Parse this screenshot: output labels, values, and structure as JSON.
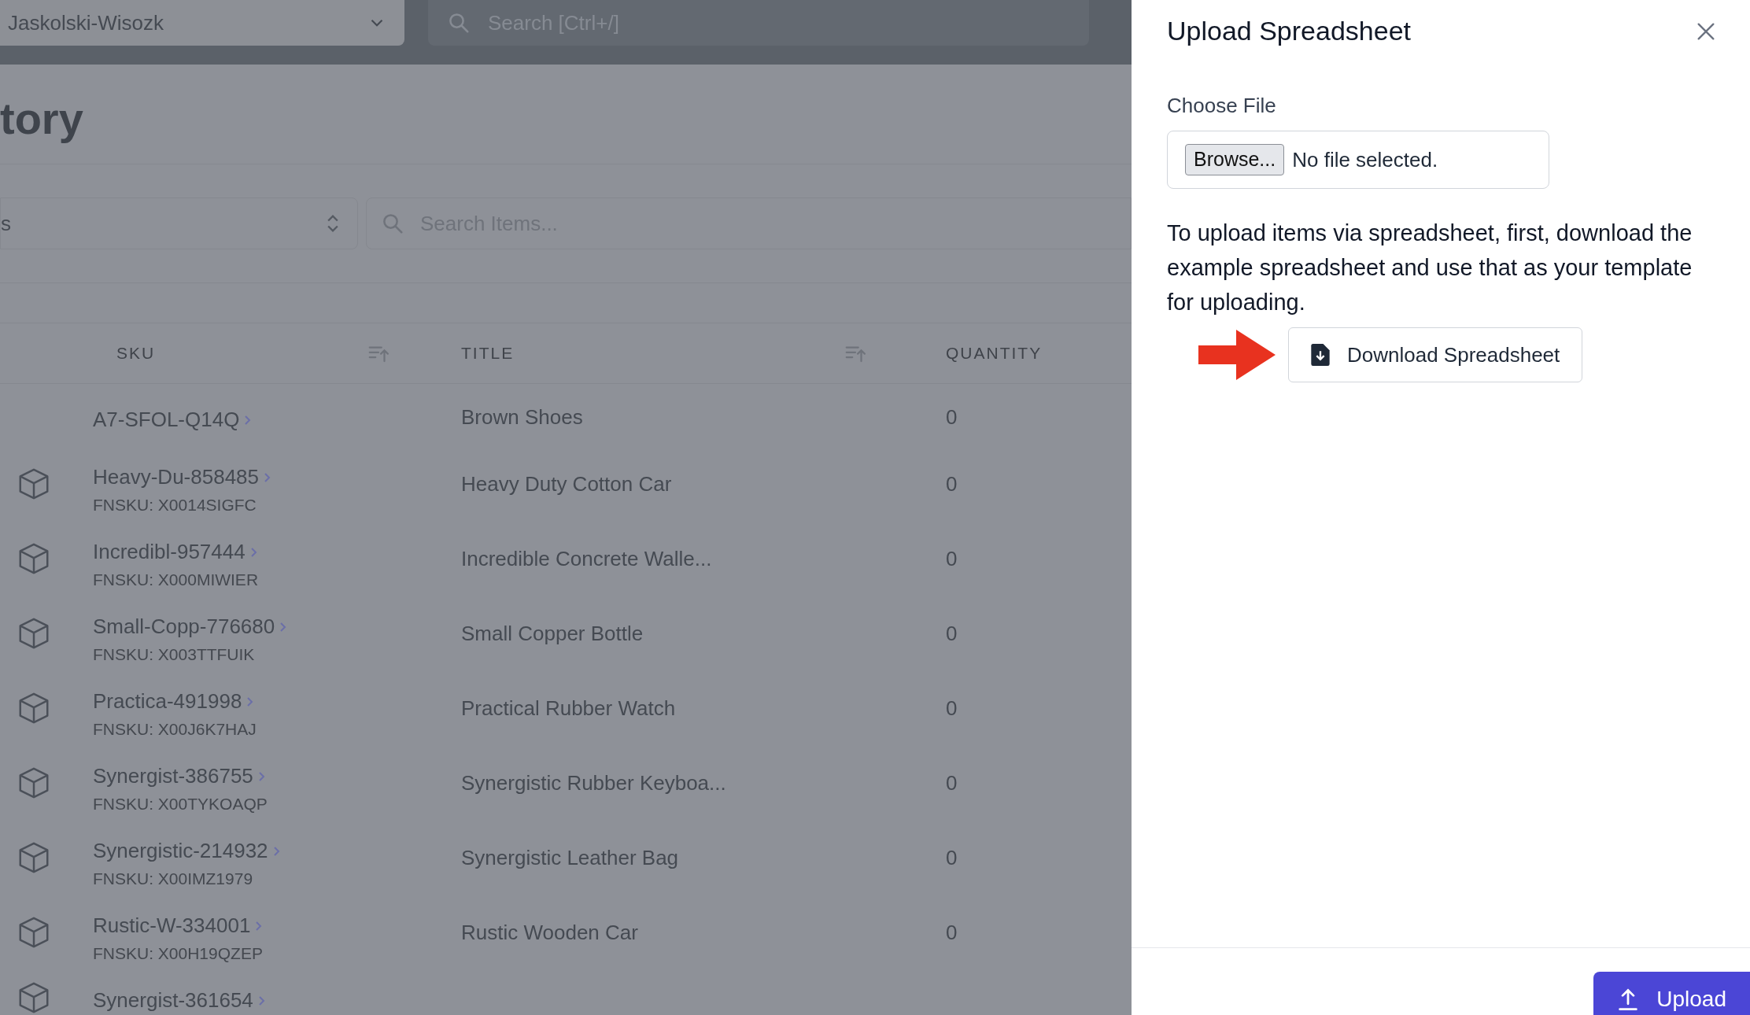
{
  "top_bar": {
    "org_select": "Jaskolski-Wisozk",
    "search_placeholder": "Search [Ctrl+/]"
  },
  "page": {
    "title": "tory",
    "filter_select": "s",
    "search_placeholder": "Search Items...",
    "table": {
      "columns": [
        {
          "label": "SKU",
          "kind": "sortable"
        },
        {
          "label": "TITLE",
          "kind": "sortable"
        },
        {
          "label": "QUANTITY",
          "kind": "plain"
        }
      ],
      "rows": [
        {
          "kind": "plain",
          "sku": "A7-SFOL-Q14Q",
          "title": "Brown Shoes",
          "quantity": "0"
        },
        {
          "kind": "box",
          "sku": "Heavy-Du-858485",
          "fnsku": "FNSKU: X0014SIGFC",
          "title": "Heavy Duty Cotton Car",
          "quantity": "0"
        },
        {
          "kind": "box",
          "sku": "Incredibl-957444",
          "fnsku": "FNSKU: X000MIWIER",
          "title": "Incredible Concrete Walle...",
          "quantity": "0"
        },
        {
          "kind": "box",
          "sku": "Small-Copp-776680",
          "fnsku": "FNSKU: X003TTFUIK",
          "title": "Small Copper Bottle",
          "quantity": "0"
        },
        {
          "kind": "box",
          "sku": "Practica-491998",
          "fnsku": "FNSKU: X00J6K7HAJ",
          "title": "Practical Rubber Watch",
          "quantity": "0"
        },
        {
          "kind": "box",
          "sku": "Synergist-386755",
          "fnsku": "FNSKU: X00TYKOAQP",
          "title": "Synergistic Rubber Keyboa...",
          "quantity": "0"
        },
        {
          "kind": "box",
          "sku": "Synergistic-214932",
          "fnsku": "FNSKU: X00IMZ1979",
          "title": "Synergistic Leather Bag",
          "quantity": "0"
        },
        {
          "kind": "box",
          "sku": "Rustic-W-334001",
          "fnsku": "FNSKU: X00H19QZEP",
          "title": "Rustic Wooden Car",
          "quantity": "0"
        },
        {
          "kind": "box",
          "sku": "Synergist-361654"
        }
      ]
    }
  },
  "panel": {
    "title": "Upload Spreadsheet",
    "file_label": "Choose File",
    "browse_button": "Browse...",
    "file_status": "No file selected.",
    "instructions": "To upload items via spreadsheet, first, download the example spreadsheet and use that as your template for uploading.",
    "download_button": "Download Spreadsheet",
    "upload_button": "Upload"
  }
}
